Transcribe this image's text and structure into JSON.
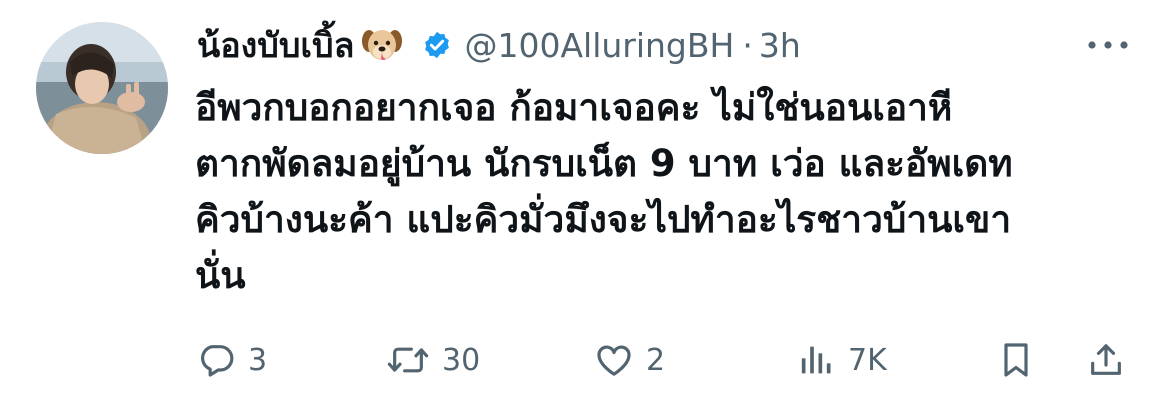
{
  "tweet": {
    "display_name": "น้องบับเบิ้ล",
    "name_emoji": "dog-face-emoji",
    "verified_icon": "verified-badge-icon",
    "handle": "@100AlluringBH",
    "separator": "·",
    "time": "3h",
    "more_icon": "more-horizontal-icon",
    "text_lines": [
      "อีพวกบอกอยากเจอ ก้อมาเจอคะ ไม่ใช่นอนเอาหี",
      "ตากพัดลมอยู่บ้าน นักรบเน็ต 9 บาท เว่อ และอัพเดท",
      "คิวบ้างนะค้า แปะคิวมั่วมึงจะไปทำอะไรชาวบ้านเขา",
      "นั่น"
    ]
  },
  "actions": {
    "reply": {
      "icon": "reply-icon",
      "count": "3"
    },
    "retweet": {
      "icon": "retweet-icon",
      "count": "30"
    },
    "like": {
      "icon": "heart-icon",
      "count": "2"
    },
    "views": {
      "icon": "views-chart-icon",
      "count": "7K"
    },
    "bookmark": {
      "icon": "bookmark-icon"
    },
    "share": {
      "icon": "share-icon"
    }
  },
  "colors": {
    "text": "#0f1419",
    "secondary": "#536471",
    "verified": "#1d9bf0",
    "background": "#ffffff"
  }
}
